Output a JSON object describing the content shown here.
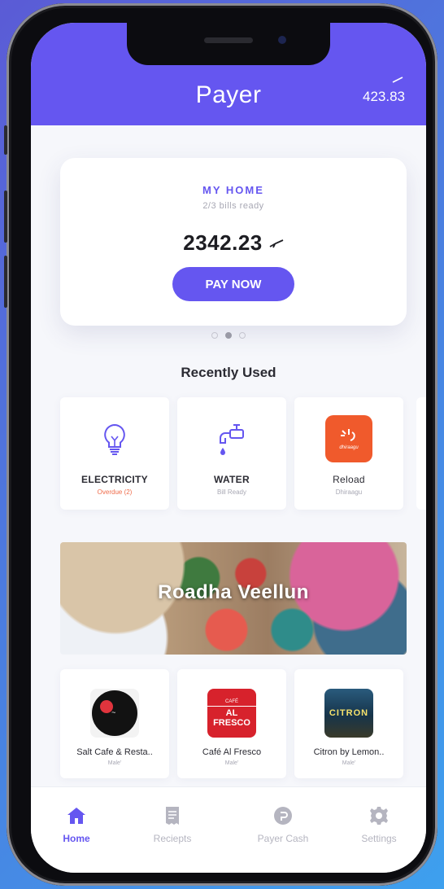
{
  "header": {
    "brand": "Payer",
    "balance": "423.83"
  },
  "home_card": {
    "title": "MY HOME",
    "subtitle": "2/3 bills ready",
    "amount": "2342.23",
    "pay_button": "PAY NOW",
    "carousel_pages": 3,
    "active_page": 2
  },
  "recently_used": {
    "title": "Recently Used",
    "items": [
      {
        "label": "ELECTRICITY",
        "status": "Overdue (2)",
        "icon": "lightbulb-icon"
      },
      {
        "label": "WATER",
        "status": "Bill Ready",
        "icon": "water-tap-icon"
      },
      {
        "label": "Reload",
        "status": "Dhiraagu",
        "icon": "dhiraagu-logo",
        "logo_text": "dhiraagu"
      }
    ]
  },
  "banner": {
    "title": "Roadha Veellun"
  },
  "shops": [
    {
      "name": "Salt Cafe & Resta..",
      "location": "Male'"
    },
    {
      "name": "Café Al Fresco",
      "location": "Male'",
      "logo_small": "CAFÉ",
      "logo_big": "AL FRESCO"
    },
    {
      "name": "Citron by Lemon..",
      "location": "Male'",
      "logo_text": "CITRON"
    }
  ],
  "tabbar": {
    "items": [
      {
        "label": "Home",
        "icon": "home-icon",
        "active": true
      },
      {
        "label": "Reciepts",
        "icon": "receipt-icon",
        "active": false
      },
      {
        "label": "Payer Cash",
        "icon": "payer-cash-icon",
        "active": false
      },
      {
        "label": "Settings",
        "icon": "gear-icon",
        "active": false
      }
    ]
  },
  "colors": {
    "accent": "#6556f0",
    "overdue": "#ef6b4a",
    "reload": "#f05a2c"
  }
}
